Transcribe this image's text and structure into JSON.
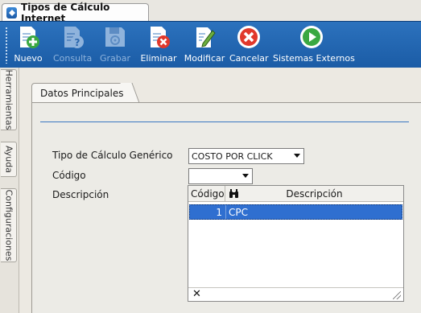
{
  "window": {
    "tab_title": "Tipos de Cálculo Internet"
  },
  "toolbar": {
    "buttons": [
      {
        "label": "Nuevo",
        "icon": "new-document-icon",
        "enabled": true
      },
      {
        "label": "Consulta",
        "icon": "query-document-icon",
        "enabled": false
      },
      {
        "label": "Grabar",
        "icon": "save-disk-icon",
        "enabled": false
      },
      {
        "label": "Eliminar",
        "icon": "delete-document-icon",
        "enabled": true
      },
      {
        "label": "Modificar",
        "icon": "edit-document-icon",
        "enabled": true
      },
      {
        "label": "Cancelar",
        "icon": "cancel-icon",
        "enabled": true
      },
      {
        "label": "Sistemas Externos",
        "icon": "play-icon",
        "enabled": true
      }
    ]
  },
  "side_tabs": [
    "Herramientas",
    "Ayuda",
    "Configuraciones"
  ],
  "panel": {
    "tab_label": "Datos Principales"
  },
  "form": {
    "tipo_label": "Tipo de Cálculo Genérico",
    "tipo_value": "COSTO POR CLICK",
    "codigo_label": "Código",
    "codigo_value": "",
    "descripcion_label": "Descripción"
  },
  "grid": {
    "columns": [
      "Código",
      "Descripción"
    ],
    "search_icon": "binoculars-icon",
    "rows": [
      {
        "codigo": "1",
        "descripcion": "CPC",
        "selected": true
      }
    ],
    "footer_close": "✕"
  },
  "colors": {
    "toolbar_bg": "#2366b1",
    "selection": "#2f6fd0",
    "accent_line": "#3b78c1"
  }
}
